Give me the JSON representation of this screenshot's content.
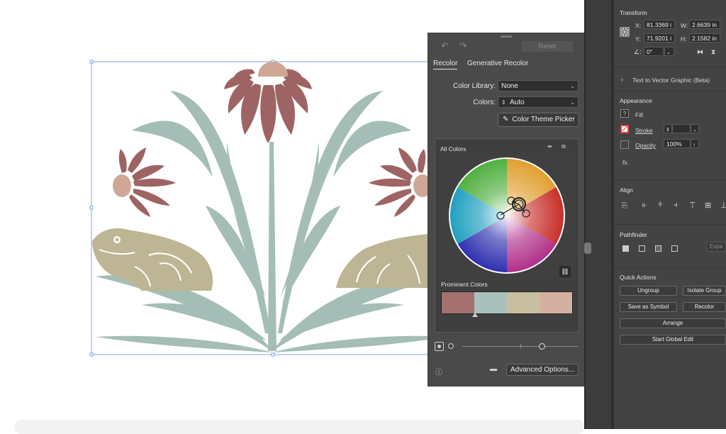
{
  "recolor": {
    "reset_label": "Reset",
    "tabs": [
      {
        "label": "Recolor",
        "active": true
      },
      {
        "label": "Generative Recolor",
        "active": false
      }
    ],
    "color_library_label": "Color Library:",
    "color_library_value": "None",
    "colors_label": "Colors:",
    "colors_value": "Auto",
    "theme_picker_label": "Color Theme Picker",
    "all_colors_label": "All Colors",
    "prominent_colors_label": "Prominent Colors",
    "prominent_colors": [
      "#a47070",
      "#aac1bb",
      "#c7bf9f",
      "#d4b0a0"
    ],
    "advanced_options_label": "Advanced Options..."
  },
  "properties": {
    "transform_title": "Transform",
    "x_label": "X:",
    "x_value": "81.3369 i",
    "y_label": "Y:",
    "y_value": "71.9201 i",
    "w_label": "W:",
    "w_value": "2.6639 in",
    "h_label": "H:",
    "h_value": "2.1582 in",
    "angle_value": "0°",
    "text_to_vector_label": "Text to Vector Graphic (Beta)",
    "appearance_title": "Appearance",
    "fill_label": "Fill",
    "stroke_label": "Stroke",
    "opacity_label": "Opacity",
    "opacity_value": "100%",
    "fx_label": "fx.",
    "align_title": "Align",
    "pathfinder_title": "Pathfinder",
    "expand_label": "Expa",
    "quick_actions_title": "Quick Actions",
    "ungroup_label": "Ungroup",
    "isolate_group_label": "Isolate Group",
    "save_symbol_label": "Save as Symbol",
    "recolor_label": "Recolor",
    "arrange_label": "Arrange",
    "global_edit_label": "Start Global Edit"
  },
  "colors": {
    "red": "#9e6464",
    "sage": "#a5bdb7",
    "khaki": "#bdb593",
    "peach": "#d0a795"
  }
}
